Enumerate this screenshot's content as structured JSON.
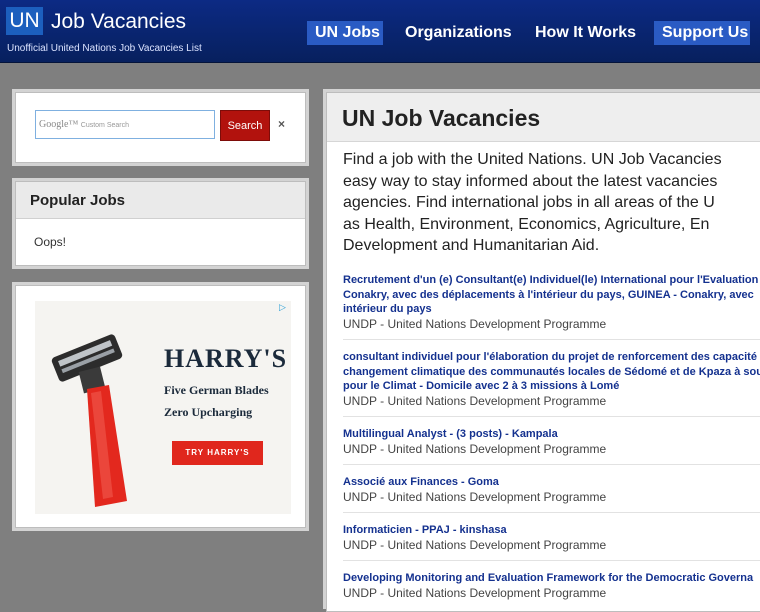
{
  "header": {
    "logo_mark": "UN",
    "logo_title": "Job Vacancies",
    "subtitle": "Unofficial United Nations Job Vacancies List",
    "nav": [
      {
        "label": "UN Jobs",
        "active": true
      },
      {
        "label": "Organizations",
        "active": false
      },
      {
        "label": "How It Works",
        "active": false
      },
      {
        "label": "Support Us",
        "active": true
      }
    ]
  },
  "search": {
    "google_label": "Google",
    "custom_label": "Custom Search",
    "button_label": "Search",
    "clear_label": "×"
  },
  "popular": {
    "title": "Popular Jobs",
    "empty_text": "Oops!"
  },
  "ad": {
    "brand": "HARRY'S",
    "line1": "Five German Blades",
    "line2": "Zero Upcharging",
    "cta": "TRY HARRY'S",
    "choice_icon": "ad-choices-icon"
  },
  "main": {
    "title": "UN Job Vacancies",
    "intro_lines": [
      "Find a job with the United Nations. UN Job Vacancies",
      "easy way to stay informed about the latest vacancies",
      "agencies. Find international jobs in all areas of the U",
      "as Health, Environment, Economics, Agriculture, En",
      "Development and Humanitarian Aid."
    ],
    "jobs": [
      {
        "title_lines": [
          "Recrutement d'un (e) Consultant(e) Individuel(le) International pour l'Evaluation",
          "Conakry, avec des déplacements à l'intérieur du pays, GUINEA - Conakry, avec",
          "intérieur du pays"
        ],
        "org": "UNDP - United Nations Development Programme"
      },
      {
        "title_lines": [
          "consultant individuel pour l'élaboration du projet de renforcement des capacité",
          "changement climatique des communautés locales de Sédomé et de Kpaza à sou",
          "pour le Climat - Domicile avec 2 à 3 missions à Lomé"
        ],
        "org": "UNDP - United Nations Development Programme"
      },
      {
        "title_lines": [
          "Multilingual Analyst - (3 posts) - Kampala"
        ],
        "org": "UNDP - United Nations Development Programme"
      },
      {
        "title_lines": [
          "Associé aux Finances - Goma"
        ],
        "org": "UNDP - United Nations Development Programme"
      },
      {
        "title_lines": [
          "Informaticien - PPAJ - kinshasa"
        ],
        "org": "UNDP - United Nations Development Programme"
      },
      {
        "title_lines": [
          "Developing Monitoring and Evaluation Framework for the Democratic Governa"
        ],
        "org": "UNDP - United Nations Development Programme"
      }
    ]
  },
  "colors": {
    "header_bg": "#0c2a84",
    "nav_active": "#2a5bc4",
    "search_button": "#b2120d",
    "job_link": "#14318f",
    "ad_cta": "#e0271d"
  }
}
